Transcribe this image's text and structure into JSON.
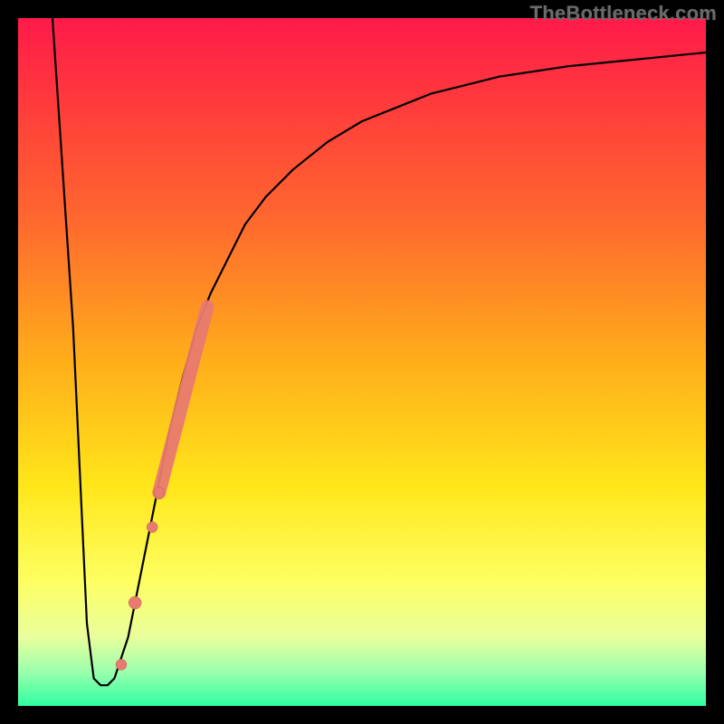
{
  "watermark": "TheBottleneck.com",
  "colors": {
    "curve": "#000000",
    "dots": "#e87b6f",
    "dots_outline": "#c45a54",
    "bg_top": "#ff1a4a",
    "bg_bottom": "#2effa1"
  },
  "chart_data": {
    "type": "line",
    "title": "",
    "xlabel": "",
    "ylabel": "",
    "xlim": [
      0,
      100
    ],
    "ylim": [
      0,
      100
    ],
    "series": [
      {
        "name": "bottleneck-curve",
        "x": [
          5,
          8,
          10,
          11,
          12,
          13,
          14,
          16,
          18,
          20,
          22,
          24,
          26,
          28,
          30,
          33,
          36,
          40,
          45,
          50,
          55,
          60,
          70,
          80,
          90,
          100
        ],
        "y": [
          100,
          55,
          12,
          4,
          3,
          3,
          4,
          10,
          20,
          30,
          40,
          48,
          55,
          60,
          64,
          70,
          74,
          78,
          82,
          85,
          87,
          89,
          91.5,
          93,
          94,
          95
        ]
      }
    ],
    "scatter": [
      {
        "name": "dot-1",
        "x": 15.0,
        "y": 6,
        "r": 6
      },
      {
        "name": "dot-2",
        "x": 17.0,
        "y": 15,
        "r": 7
      },
      {
        "name": "dot-3",
        "x": 19.5,
        "y": 26,
        "r": 6
      },
      {
        "name": "dot-4",
        "x": 20.5,
        "y": 31,
        "r": 6
      }
    ],
    "thick_segment": {
      "name": "highlight-segment",
      "x0": 20.5,
      "y0": 31,
      "x1": 27.5,
      "y1": 58,
      "width": 15
    }
  }
}
